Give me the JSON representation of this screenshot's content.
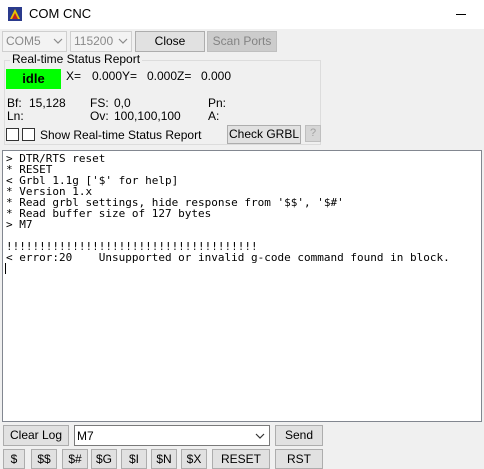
{
  "window": {
    "title": "COM CNC"
  },
  "connection": {
    "port": "COM5",
    "baud": "115200",
    "close_label": "Close",
    "scan_label": "Scan Ports"
  },
  "status": {
    "group_title": "Real-time Status Report",
    "state": "idle",
    "state_color": "#00ff00",
    "x_label": "X=",
    "x_value": "0.000",
    "y_label": "Y=",
    "y_value": "0.000",
    "z_label": "Z=",
    "z_value": "0.000",
    "bf_label": "Bf:",
    "bf_value": "15,128",
    "fs_label": "FS:",
    "fs_value": "0,0",
    "pn_label": "Pn:",
    "ln_label": "Ln:",
    "ov_label": "Ov:",
    "ov_value": "100,100,100",
    "a_label": "A:",
    "show_realtime_label": "Show Real-time Status Report",
    "check_grbl_label": "Check GRBL",
    "help_label": "?"
  },
  "console": {
    "lines": [
      "> DTR/RTS reset",
      "* RESET",
      "< Grbl 1.1g ['$' for help]",
      "* Version 1.x",
      "* Read grbl settings, hide response from '$$', '$#'",
      "* Read buffer size of 127 bytes",
      "> M7",
      "",
      "!!!!!!!!!!!!!!!!!!!!!!!!!!!!!!!!!!!!!!",
      "< error:20    Unsupported or invalid g-code command found in block."
    ]
  },
  "command": {
    "clear_log_label": "Clear Log",
    "input_value": "M7",
    "send_label": "Send"
  },
  "quick_buttons": [
    "$",
    "$$",
    "$#",
    "$G",
    "$I",
    "$N",
    "$X",
    "RESET",
    "RST"
  ]
}
